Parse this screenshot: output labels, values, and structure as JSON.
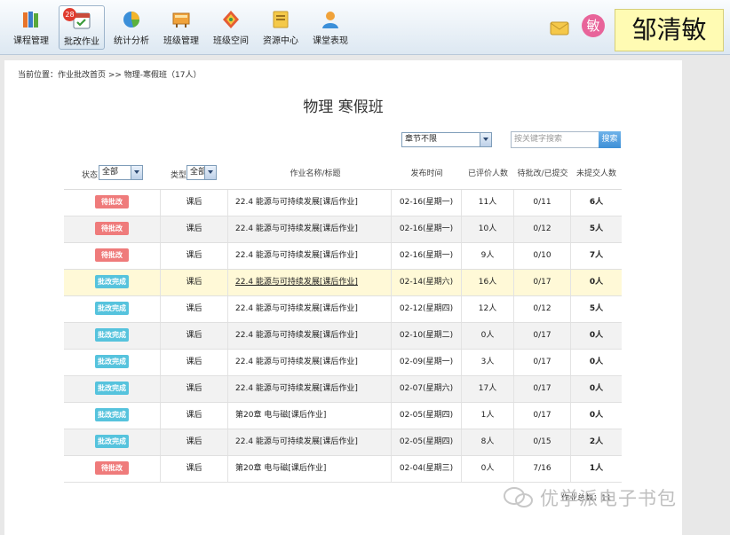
{
  "nav": {
    "items": [
      {
        "label": "课程管理",
        "icon": "books-icon"
      },
      {
        "label": "批改作业",
        "icon": "calendar-check-icon",
        "badge": "28",
        "active": true
      },
      {
        "label": "统计分析",
        "icon": "pie-chart-icon"
      },
      {
        "label": "班级管理",
        "icon": "class-board-icon"
      },
      {
        "label": "班级空间",
        "icon": "diamond-space-icon"
      },
      {
        "label": "资源中心",
        "icon": "folder-icon"
      },
      {
        "label": "课堂表现",
        "icon": "user-icon"
      }
    ],
    "avatar_char": "敏",
    "user_name": "邹清敏"
  },
  "breadcrumb": "当前位置：作业批改首页 >> 物理-寒假班（17人）",
  "page_title": "物理  寒假班",
  "filters": {
    "chapter_value": "章节不限",
    "search_placeholder": "按关键字搜索",
    "search_button": "搜索",
    "status_label": "状态",
    "status_value": "全部",
    "type_label": "类型",
    "type_value": "全部"
  },
  "columns": {
    "name": "作业名称/标题",
    "date": "发布时间",
    "evaluated": "已评价人数",
    "pending": "待批改/已提交",
    "unsubmitted": "未提交人数"
  },
  "rows": [
    {
      "status": "待批改",
      "status_kind": "pending",
      "type": "课后",
      "name": "22.4 能源与可持续发展[课后作业]",
      "date": "02-16(星期一)",
      "evaluated": "11人",
      "pending": "0/11",
      "unsubmitted": "6人"
    },
    {
      "status": "待批改",
      "status_kind": "pending",
      "type": "课后",
      "name": "22.4 能源与可持续发展[课后作业]",
      "date": "02-16(星期一)",
      "evaluated": "10人",
      "pending": "0/12",
      "unsubmitted": "5人"
    },
    {
      "status": "待批改",
      "status_kind": "pending",
      "type": "课后",
      "name": "22.4 能源与可持续发展[课后作业]",
      "date": "02-16(星期一)",
      "evaluated": "9人",
      "pending": "0/10",
      "unsubmitted": "7人"
    },
    {
      "status": "批改完成",
      "status_kind": "done",
      "type": "课后",
      "name": "22.4 能源与可持续发展[课后作业]",
      "date": "02-14(星期六)",
      "evaluated": "16人",
      "pending": "0/17",
      "unsubmitted": "0人"
    },
    {
      "status": "批改完成",
      "status_kind": "done",
      "type": "课后",
      "name": "22.4 能源与可持续发展[课后作业]",
      "date": "02-12(星期四)",
      "evaluated": "12人",
      "pending": "0/12",
      "unsubmitted": "5人"
    },
    {
      "status": "批改完成",
      "status_kind": "done",
      "type": "课后",
      "name": "22.4 能源与可持续发展[课后作业]",
      "date": "02-10(星期二)",
      "evaluated": "0人",
      "pending": "0/17",
      "unsubmitted": "0人"
    },
    {
      "status": "批改完成",
      "status_kind": "done",
      "type": "课后",
      "name": "22.4 能源与可持续发展[课后作业]",
      "date": "02-09(星期一)",
      "evaluated": "3人",
      "pending": "0/17",
      "unsubmitted": "0人"
    },
    {
      "status": "批改完成",
      "status_kind": "done",
      "type": "课后",
      "name": "22.4 能源与可持续发展[课后作业]",
      "date": "02-07(星期六)",
      "evaluated": "17人",
      "pending": "0/17",
      "unsubmitted": "0人"
    },
    {
      "status": "批改完成",
      "status_kind": "done",
      "type": "课后",
      "name": "第20章 电与磁[课后作业]",
      "date": "02-05(星期四)",
      "evaluated": "1人",
      "pending": "0/17",
      "unsubmitted": "0人"
    },
    {
      "status": "批改完成",
      "status_kind": "done",
      "type": "课后",
      "name": "22.4 能源与可持续发展[课后作业]",
      "date": "02-05(星期四)",
      "evaluated": "8人",
      "pending": "0/15",
      "unsubmitted": "2人"
    },
    {
      "status": "待批改",
      "status_kind": "pending",
      "type": "课后",
      "name": "第20章 电与磁[课后作业]",
      "date": "02-04(星期三)",
      "evaluated": "0人",
      "pending": "7/16",
      "unsubmitted": "1人"
    }
  ],
  "highlight_row": 3,
  "footer_total": "作业总数：11",
  "watermark": "优学派电子书包",
  "colors": {
    "pending": "#ef7b7b",
    "done": "#56c3dd",
    "highlight": "#fff9d7",
    "name_tag": "#fffbb3"
  }
}
